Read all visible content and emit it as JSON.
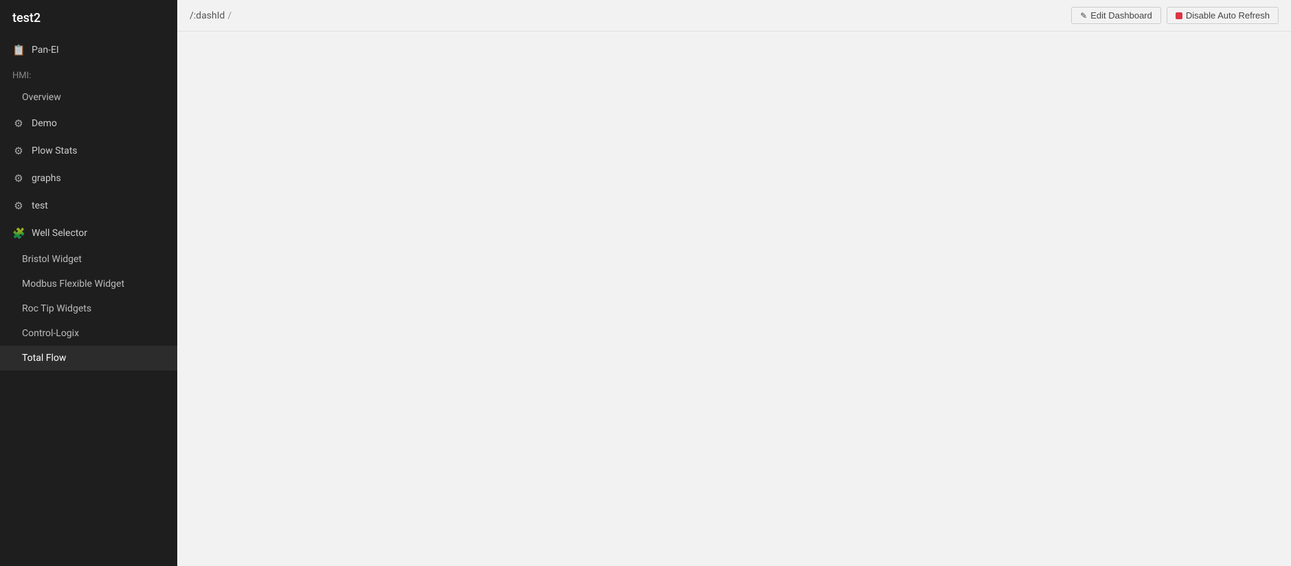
{
  "app": {
    "title": "test2"
  },
  "sidebar": {
    "title": "test2",
    "sections": [
      {
        "label": "Pan-EI",
        "type": "section-header",
        "icon": "📋"
      },
      {
        "label": "HMI:",
        "type": "sub-label"
      },
      {
        "label": "Overview",
        "type": "sub-item",
        "active": false
      },
      {
        "label": "Demo",
        "type": "item",
        "icon": "⚙",
        "active": false
      },
      {
        "label": "Plow Stats",
        "type": "item",
        "icon": "⚙",
        "active": false
      },
      {
        "label": "graphs",
        "type": "item",
        "icon": "⚙",
        "active": false
      },
      {
        "label": "test",
        "type": "item",
        "icon": "⚙",
        "active": false
      },
      {
        "label": "Well Selector",
        "type": "item",
        "icon": "🧩",
        "active": false
      },
      {
        "label": "Bristol Widget",
        "type": "sub-item",
        "active": false
      },
      {
        "label": "Modbus Flexible Widget",
        "type": "sub-item",
        "active": false
      },
      {
        "label": "Roc Tip Widgets",
        "type": "sub-item",
        "active": false
      },
      {
        "label": "Control-Logix",
        "type": "sub-item",
        "active": false
      },
      {
        "label": "Total Flow",
        "type": "sub-item",
        "active": true
      }
    ]
  },
  "topbar": {
    "breadcrumb": {
      "path": "/:dashId",
      "separator": "/"
    },
    "edit_dashboard_label": "Edit Dashboard",
    "disable_auto_refresh_label": "Disable Auto Refresh"
  },
  "icons": {
    "edit": "✎",
    "gear": "⚙",
    "puzzle": "🧩",
    "panel": "📋"
  }
}
